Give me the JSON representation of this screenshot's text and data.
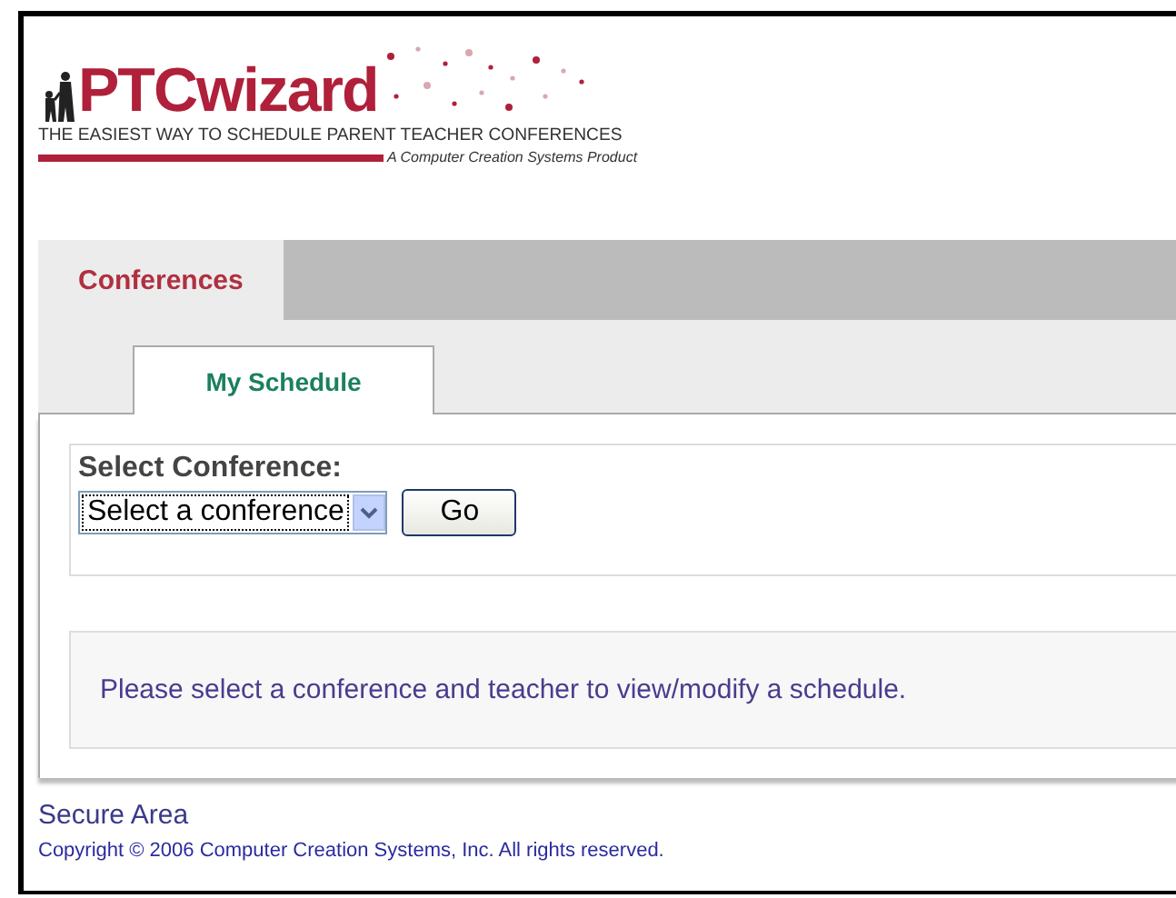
{
  "logo": {
    "name": "PTCwizard",
    "tagline": "THE EASIEST WAY TO SCHEDULE PARENT TEACHER CONFERENCES",
    "product": "A Computer Creation Systems Product"
  },
  "tabs": [
    {
      "label": "Conferences",
      "selected": true
    }
  ],
  "subtabs": [
    {
      "label": "My Schedule",
      "selected": true
    }
  ],
  "form": {
    "label": "Select Conference:",
    "select": {
      "value": "Select a conference"
    },
    "button": "Go"
  },
  "message": "Please select a conference and teacher to view/modify a schedule.",
  "footer": {
    "title": "Secure Area",
    "copyright": "Copyright © 2006 Computer Creation Systems, Inc. All rights reserved."
  }
}
